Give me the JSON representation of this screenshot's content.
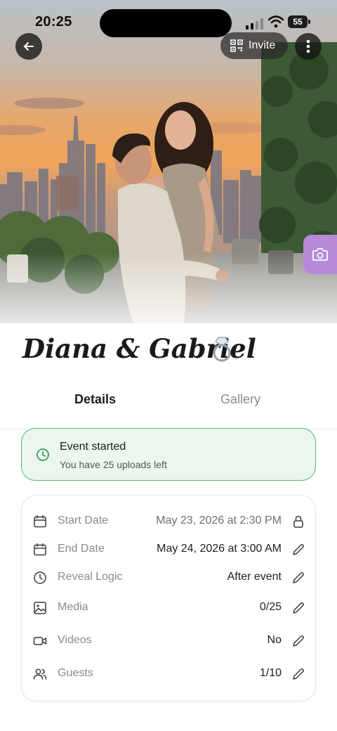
{
  "status_bar": {
    "time": "20:25",
    "battery": "55"
  },
  "header": {
    "invite_label": "Invite"
  },
  "event": {
    "title": "Diana & Gabriel"
  },
  "tabs": [
    {
      "label": "Details",
      "active": true
    },
    {
      "label": "Gallery",
      "active": false
    }
  ],
  "status_banner": {
    "title": "Event started",
    "subtitle": "You have 25 uploads left",
    "accent": "#58b777"
  },
  "details": {
    "rows": [
      {
        "icon": "calendar-icon",
        "label": "Start Date",
        "value": "May 23, 2026 at 2:30 PM",
        "action_icon": "lock-icon"
      },
      {
        "icon": "calendar-icon",
        "label": "End Date",
        "value": "May 24, 2026 at 3:00 AM",
        "action_icon": "pencil-icon"
      },
      {
        "icon": "clock-icon",
        "label": "Reveal Logic",
        "value": "After event",
        "action_icon": "pencil-icon"
      },
      {
        "icon": "image-icon",
        "label": "Media",
        "value": "0/25",
        "action_icon": "pencil-icon"
      },
      {
        "icon": "video-icon",
        "label": "Videos",
        "value": "No",
        "action_icon": "pencil-icon"
      },
      {
        "icon": "users-icon",
        "label": "Guests",
        "value": "1/10",
        "action_icon": "pencil-icon"
      }
    ]
  },
  "colors": {
    "camera_button": "#b68ad8",
    "banner_background": "#eaf6ee"
  }
}
